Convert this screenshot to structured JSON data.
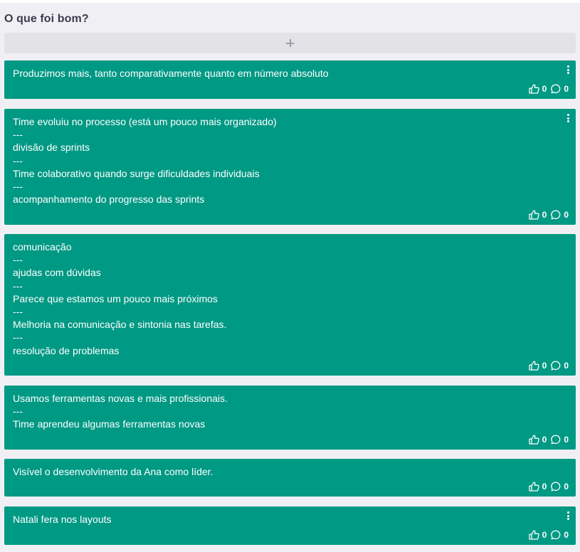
{
  "column": {
    "title": "O que foi bom?"
  },
  "icons": {
    "add": "plus-icon",
    "menu": "vertical-dots-icon",
    "like": "thumbs-up-icon",
    "comment": "speech-bubble-icon"
  },
  "colors": {
    "card": "#009984",
    "column_bg": "#f0f0f4",
    "add_button": "#e2e2e7",
    "title": "#3d3a4e"
  },
  "cards": [
    {
      "text": "Produzimos mais, tanto comparativamente quanto em número absoluto",
      "likes": "0",
      "comments": "0"
    },
    {
      "text": "Time evoluiu no processo (está um pouco mais organizado)\n---\ndivisão de sprints\n---\nTime colaborativo quando surge dificuldades individuais\n---\nacompanhamento do progresso das sprints",
      "likes": "0",
      "comments": "0"
    },
    {
      "text": "comunicação\n---\najudas com dúvidas\n---\nParece que estamos um pouco mais próximos\n---\nMelhoria na comunicação e sintonia nas tarefas.\n---\nresolução de problemas",
      "likes": "0",
      "comments": "0"
    },
    {
      "text": "Usamos ferramentas novas e mais profissionais.\n---\nTime aprendeu algumas ferramentas novas",
      "likes": "0",
      "comments": "0"
    },
    {
      "text": "Visível o desenvolvimento da Ana como líder.",
      "likes": "0",
      "comments": "0"
    },
    {
      "text": "Natali fera nos layouts",
      "likes": "0",
      "comments": "0"
    }
  ]
}
